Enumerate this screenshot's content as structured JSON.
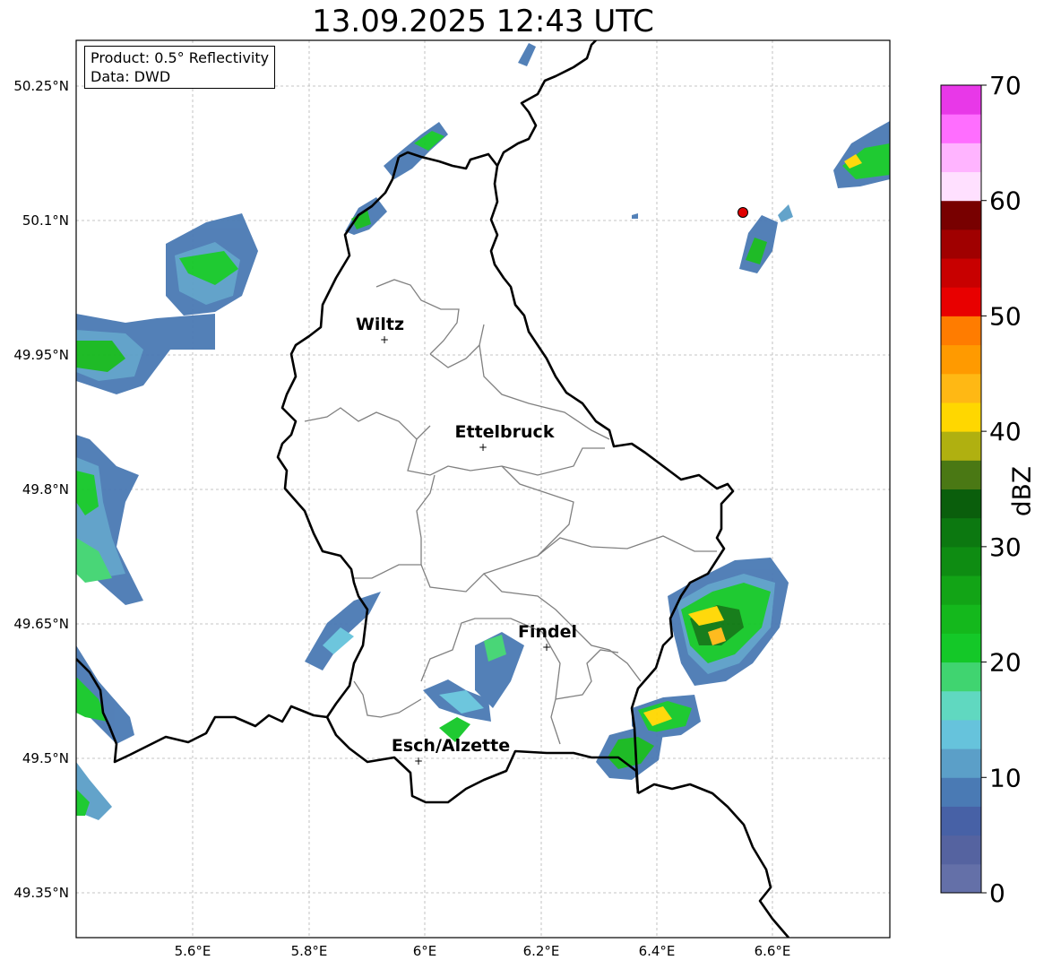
{
  "title": "13.09.2025 12:43 UTC",
  "info_box": {
    "line1": "Product: 0.5° Reflectivity",
    "line2": "Data: DWD"
  },
  "lat_ticks": [
    "50.25°N",
    "50.1°N",
    "49.95°N",
    "49.8°N",
    "49.65°N",
    "49.5°N",
    "49.35°N"
  ],
  "lon_ticks": [
    "5.6°E",
    "5.8°E",
    "6°E",
    "6.2°E",
    "6.4°E",
    "6.6°E"
  ],
  "cities": [
    {
      "name": "Wiltz",
      "lon": 5.93,
      "lat": 49.97
    },
    {
      "name": "Ettelbruck",
      "lon": 6.1,
      "lat": 49.85
    },
    {
      "name": "Findel",
      "lon": 6.21,
      "lat": 49.627
    },
    {
      "name": "Esch/Alzette",
      "lon": 5.99,
      "lat": 49.5
    }
  ],
  "colorbar": {
    "label": "dBZ",
    "ticks": [
      "0",
      "10",
      "20",
      "30",
      "40",
      "50",
      "60",
      "70"
    ],
    "colors": [
      "#6470a8",
      "#5563a0",
      "#4761a6",
      "#4a7ab4",
      "#5b9fc8",
      "#66c3dc",
      "#60d8c0",
      "#40d470",
      "#14c828",
      "#14b81c",
      "#12a416",
      "#0e8c12",
      "#0c7810",
      "#0a5e0c",
      "#4a7814",
      "#b0b010",
      "#ffd700",
      "#ffb814",
      "#ff9a00",
      "#ff7c00",
      "#e80000",
      "#c80000",
      "#a00000",
      "#780000",
      "#ffe0ff",
      "#ffb4ff",
      "#ff6eff",
      "#e838e8"
    ]
  },
  "colors": {
    "border": "#000000",
    "cantons": "#808080",
    "grid": "#b0b0b0",
    "marker": "#e00000"
  },
  "marker": {
    "lon": 6.55,
    "lat": 50.11
  }
}
